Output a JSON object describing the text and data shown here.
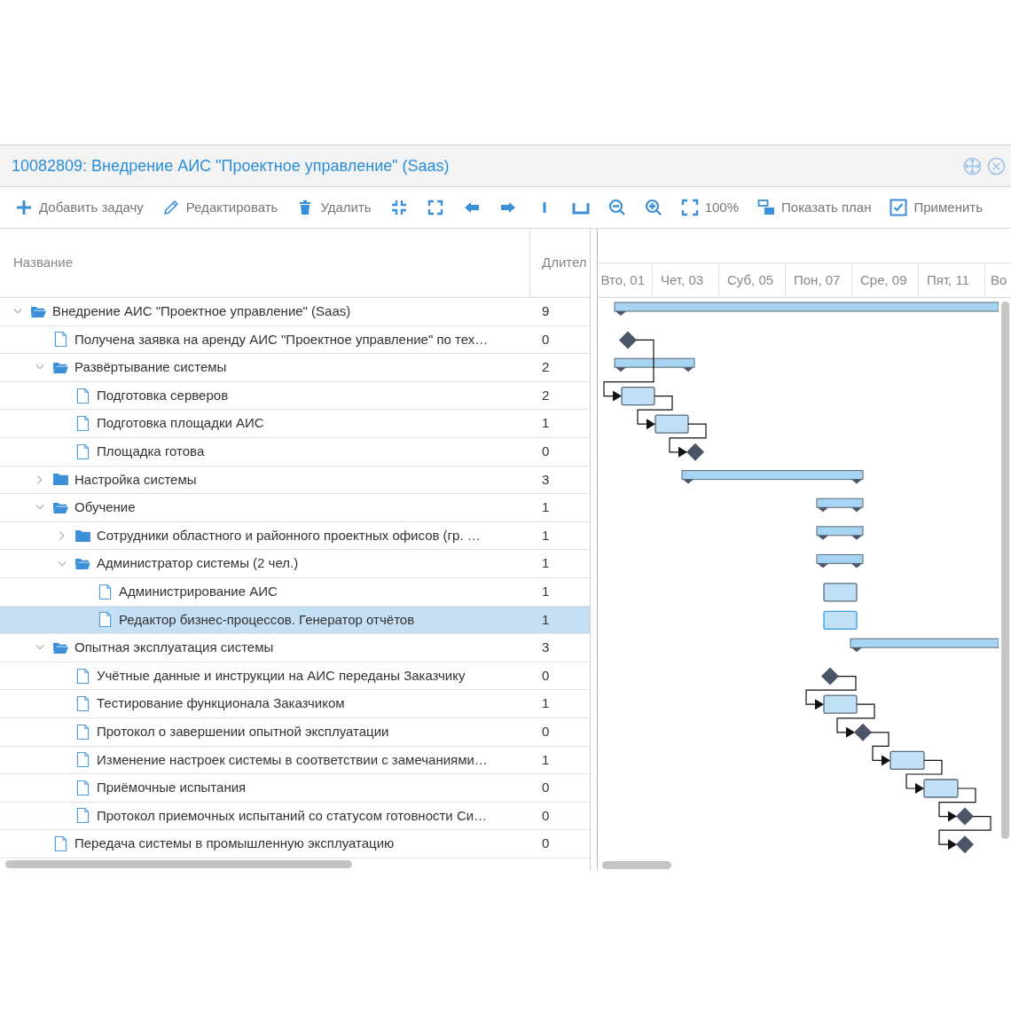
{
  "window": {
    "title": "10082809: Внедрение АИС \"Проектное управление\" (Saas)"
  },
  "toolbar": [
    {
      "label": "Добавить задачу"
    },
    {
      "label": "Редактировать"
    },
    {
      "label": "Удалить"
    },
    {
      "label": "100%"
    },
    {
      "label": "Показать план"
    },
    {
      "label": "Применить"
    }
  ],
  "grid": {
    "columns": [
      "Название",
      "Длител"
    ]
  },
  "timeline": {
    "days": [
      "Вто, 01",
      "Чет, 03",
      "Суб, 05",
      "Пон, 07",
      "Сре, 09",
      "Пят, 11",
      "Во"
    ]
  },
  "tasks": [
    {
      "kind": "folder",
      "name": "Внедрение АИС \"Проектное управление\" (Saas)",
      "duration": "9",
      "expanded": true,
      "selected": false,
      "bar": {
        "kind": "summary"
      },
      "children": [
        {
          "kind": "task",
          "name": "Получена заявка на аренду АИС \"Проектное управление\" по тех…",
          "duration": "0",
          "selected": false,
          "bar": {
            "kind": "milestone"
          }
        },
        {
          "kind": "folder",
          "name": "Развёртывание системы",
          "duration": "2",
          "expanded": true,
          "selected": false,
          "bar": {
            "kind": "summary"
          },
          "children": [
            {
              "kind": "task",
              "name": "Подготовка серверов",
              "duration": "2",
              "selected": false,
              "bar": {
                "kind": "task"
              }
            },
            {
              "kind": "task",
              "name": "Подготовка площадки АИС",
              "duration": "1",
              "selected": false,
              "bar": {
                "kind": "task"
              }
            },
            {
              "kind": "task",
              "name": "Площадка готова",
              "duration": "0",
              "selected": false,
              "bar": {
                "kind": "milestone"
              }
            }
          ]
        },
        {
          "kind": "folder",
          "name": "Настройка системы",
          "duration": "3",
          "expanded": false,
          "selected": false,
          "bar": {
            "kind": "summary"
          }
        },
        {
          "kind": "folder",
          "name": "Обучение",
          "duration": "1",
          "expanded": true,
          "selected": false,
          "bar": {
            "kind": "summary"
          },
          "children": [
            {
              "kind": "folder",
              "name": "Сотрудники областного и районного проектных офисов (гр. …",
              "duration": "1",
              "expanded": false,
              "selected": false,
              "bar": {
                "kind": "summary"
              }
            },
            {
              "kind": "folder",
              "name": "Администратор системы (2 чел.)",
              "duration": "1",
              "expanded": true,
              "selected": false,
              "bar": {
                "kind": "summary"
              },
              "children": [
                {
                  "kind": "task",
                  "name": "Администрирование АИС",
                  "duration": "1",
                  "selected": false,
                  "bar": {
                    "kind": "task"
                  }
                },
                {
                  "kind": "task",
                  "name": "Редактор бизнес-процессов. Генератор отчётов",
                  "duration": "1",
                  "selected": true,
                  "bar": {
                    "kind": "task"
                  }
                }
              ]
            }
          ]
        },
        {
          "kind": "folder",
          "name": "Опытная эксплуатация системы",
          "duration": "3",
          "expanded": true,
          "selected": false,
          "bar": {
            "kind": "summary"
          },
          "children": [
            {
              "kind": "task",
              "name": "Учётные данные и инструкции на АИС переданы Заказчику",
              "duration": "0",
              "selected": false,
              "bar": {
                "kind": "milestone"
              }
            },
            {
              "kind": "task",
              "name": "Тестирование функционала Заказчиком",
              "duration": "1",
              "selected": false,
              "bar": {
                "kind": "task"
              }
            },
            {
              "kind": "task",
              "name": "Протокол о завершении опытной эксплуатации",
              "duration": "0",
              "selected": false,
              "bar": {
                "kind": "milestone"
              }
            },
            {
              "kind": "task",
              "name": "Изменение настроек системы в соответствии с замечаниями…",
              "duration": "1",
              "selected": false,
              "bar": {
                "kind": "task"
              }
            },
            {
              "kind": "task",
              "name": "Приёмочные испытания",
              "duration": "0",
              "selected": false,
              "bar": {
                "kind": "task"
              }
            },
            {
              "kind": "task",
              "name": "Протокол приемочных испытаний со статусом готовности Си…",
              "duration": "0",
              "selected": false,
              "bar": {
                "kind": "milestone"
              }
            }
          ]
        },
        {
          "kind": "task",
          "name": "Передача системы в промышленную эксплуатацию",
          "duration": "0",
          "selected": false,
          "bar": {
            "kind": "milestone"
          }
        }
      ]
    }
  ]
}
